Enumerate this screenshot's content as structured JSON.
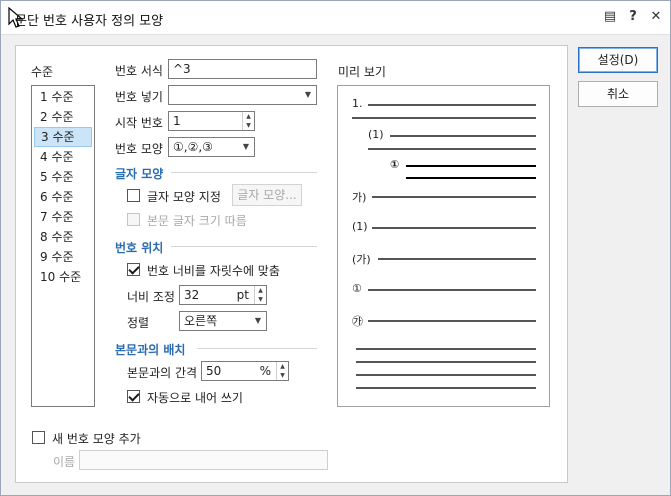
{
  "window": {
    "title": "문단 번호 사용자 정의 모양",
    "help_glyph": "?",
    "close_glyph": "✕",
    "comment_glyph": "▤"
  },
  "level": {
    "header": "수준",
    "items": [
      "1 수준",
      "2 수준",
      "3 수준",
      "4 수준",
      "5 수준",
      "6 수준",
      "7 수준",
      "8 수준",
      "9 수준",
      "10 수준"
    ],
    "selected_index": 2
  },
  "form": {
    "number_format_label": "번호 서식",
    "number_format_value": "^3",
    "insert_number_label": "번호 넣기",
    "insert_number_value": "",
    "start_number_label": "시작 번호",
    "start_number_value": "1",
    "number_shape_label": "번호 모양",
    "number_shape_value": "①,②,③"
  },
  "char_shape": {
    "section_title": "글자 모양",
    "specify_label": "글자 모양 지정",
    "specify_checked": false,
    "button_label": "글자 모양...",
    "follow_body_label": "본문 글자 크기 따름",
    "follow_body_checked": false
  },
  "number_position": {
    "section_title": "번호 위치",
    "fit_width_label": "번호 너비를 자릿수에 맞춤",
    "fit_width_checked": true,
    "width_adjust_label": "너비 조정",
    "width_adjust_value": "32",
    "width_adjust_unit": "pt",
    "align_label": "정렬",
    "align_value": "오른쪽"
  },
  "body_layout": {
    "section_title": "본문과의 배치",
    "gap_label": "본문과의 간격",
    "gap_value": "50",
    "gap_unit": "%",
    "auto_indent_label": "자동으로 내어 쓰기",
    "auto_indent_checked": true
  },
  "preview": {
    "title": "미리 보기",
    "markers": [
      "1.",
      "(1)",
      "①",
      "가)",
      "(1)",
      "(가)",
      "①",
      "㉮"
    ]
  },
  "new_shape": {
    "add_label": "새 번호 모양 추가",
    "add_checked": false,
    "name_label": "이름",
    "name_value": ""
  },
  "buttons": {
    "ok": "설정(D)",
    "cancel": "취소"
  }
}
